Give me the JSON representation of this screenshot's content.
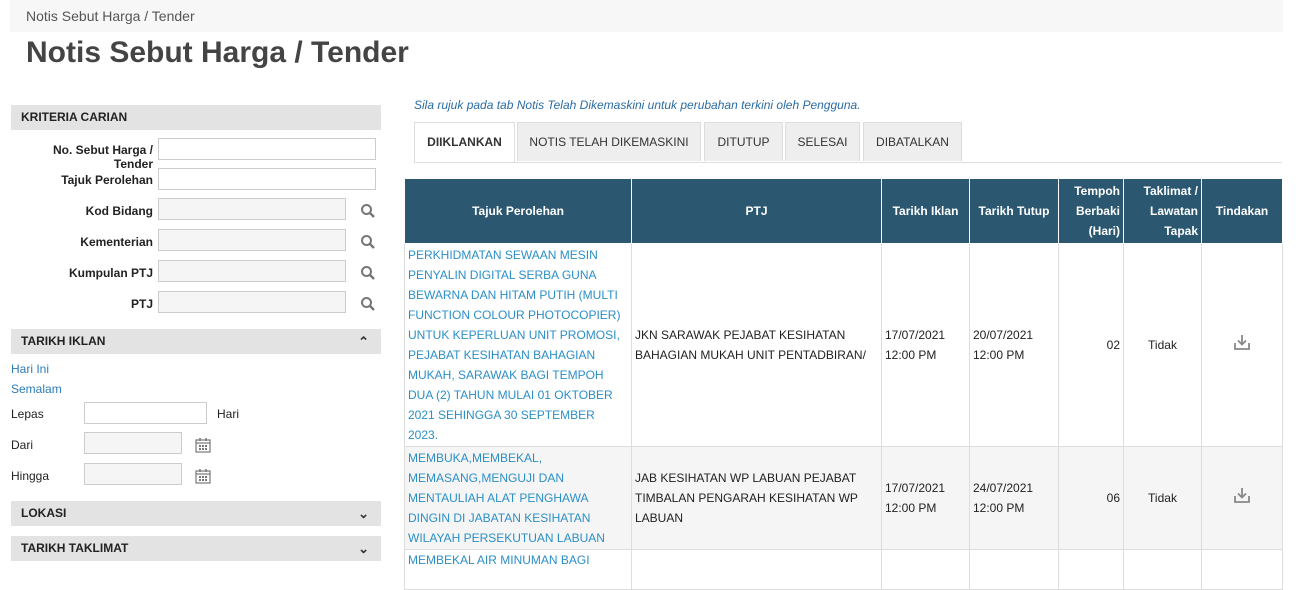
{
  "breadcrumb": "Notis Sebut Harga / Tender",
  "page_title": "Notis Sebut Harga / Tender",
  "search": {
    "header": "KRITERIA CARIAN",
    "fields": {
      "no": "No. Sebut Harga / Tender",
      "tajuk": "Tajuk Perolehan",
      "kod": "Kod Bidang",
      "kementerian": "Kementerian",
      "kumpulan": "Kumpulan PTJ",
      "ptj": "PTJ"
    }
  },
  "tarikh_iklan": {
    "header": "TARIKH IKLAN",
    "hari_ini": "Hari Ini",
    "semalam": "Semalam",
    "lepas": "Lepas",
    "hari": "Hari",
    "dari": "Dari",
    "hingga": "Hingga"
  },
  "lokasi": "LOKASI",
  "tarikh_taklimat": "TARIKH TAKLIMAT",
  "notice": "Sila rujuk pada tab Notis Telah Dikemaskini untuk perubahan terkini oleh Pengguna.",
  "tabs": [
    "DIIKLANKAN",
    "NOTIS TELAH DIKEMASKINI",
    "DITUTUP",
    "SELESAI",
    "DIBATALKAN"
  ],
  "table": {
    "headers": [
      "Tajuk Perolehan",
      "PTJ",
      "Tarikh Iklan",
      "Tarikh Tutup",
      "Tempoh Berbaki (Hari)",
      "Taklimat / Lawatan Tapak",
      "Tindakan"
    ],
    "rows": [
      {
        "tajuk": "PERKHIDMATAN SEWAAN MESIN PENYALIN DIGITAL SERBA GUNA BEWARNA DAN HITAM PUTIH (MULTI FUNCTION COLOUR PHOTOCOPIER) UNTUK KEPERLUAN UNIT PROMOSI, PEJABAT KESIHATAN BAHAGIAN MUKAH, SARAWAK BAGI TEMPOH DUA (2) TAHUN MULAI 01 OKTOBER 2021 SEHINGGA 30 SEPTEMBER 2023.",
        "ptj": "JKN SARAWAK PEJABAT KESIHATAN BAHAGIAN MUKAH UNIT PENTADBIRAN/",
        "iklan_date": "17/07/2021",
        "iklan_time": "12:00 PM",
        "tutup_date": "20/07/2021",
        "tutup_time": "12:00 PM",
        "tempoh": "02",
        "taklimat": "Tidak"
      },
      {
        "tajuk": "MEMBUKA,MEMBEKAL, MEMASANG,MENGUJI DAN MENTAULIAH ALAT PENGHAWA DINGIN DI JABATAN KESIHATAN WILAYAH PERSEKUTUAN LABUAN",
        "ptj": "JAB KESIHATAN WP LABUAN PEJABAT TIMBALAN PENGARAH KESIHATAN WP LABUAN",
        "iklan_date": "17/07/2021",
        "iklan_time": "12:00 PM",
        "tutup_date": "24/07/2021",
        "tutup_time": "12:00 PM",
        "tempoh": "06",
        "taklimat": "Tidak"
      },
      {
        "tajuk": "MEMBEKAL AIR MINUMAN BAGI",
        "ptj": "",
        "iklan_date": "",
        "iklan_time": "",
        "tutup_date": "",
        "tutup_time": "",
        "tempoh": "",
        "taklimat": ""
      }
    ]
  }
}
